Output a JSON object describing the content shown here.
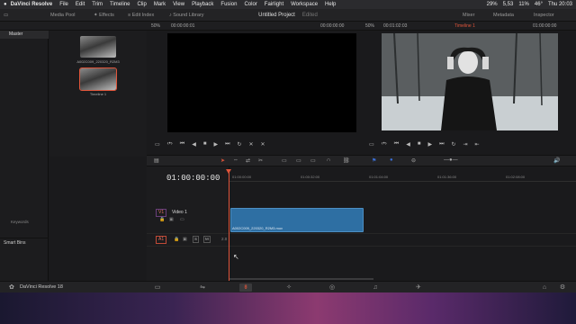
{
  "menubar": {
    "app": "DaVinci Resolve",
    "items": [
      "File",
      "Edit",
      "Trim",
      "Timeline",
      "Clip",
      "Mark",
      "View",
      "Playback",
      "Fusion",
      "Color",
      "Fairlight",
      "Workspace",
      "Help"
    ],
    "battery": "29%",
    "cpu": "5,53",
    "volume": "11%",
    "temp": "46°",
    "clock": "Thu 20:03"
  },
  "toolbar": {
    "media_pool": "Media Pool",
    "effects": "Effects",
    "edit_index": "Edit Index",
    "sound_library": "Sound Library",
    "project_title": "Untitled Project",
    "edited": "Edited",
    "mixer": "Mixer",
    "metadata": "Metadata",
    "inspector": "Inspector"
  },
  "bar2": {
    "src_zoom": "50%",
    "src_tc_left": "00:00:00:01",
    "src_tc_right": "00:00:00:00",
    "prog_zoom": "50%",
    "prog_tc": "00:01:02:03",
    "timeline_name": "Timeline 1",
    "prog_tc_right": "01:00:00:00"
  },
  "left_panel": {
    "master": "Master",
    "smart_bins": "Smart Bins",
    "keywords": "Keywords"
  },
  "media_pool": {
    "clips": [
      {
        "label": "A002C009_220320_R2M3"
      },
      {
        "label": "Timeline 1"
      }
    ]
  },
  "timeline": {
    "timecode": "01:00:00:00",
    "ruler": [
      "01:00:00:00",
      "01:00:32:00",
      "01:01:04:00",
      "01:01:36:00",
      "01:02:08:00"
    ],
    "video_track": {
      "tag": "V1",
      "name": "Video 1"
    },
    "audio_track": {
      "tag": "A1",
      "level": "2.0"
    },
    "clip_name": "A002C009_220320_R2M3.mov"
  },
  "bottom": {
    "app_label": "DaVinci Resolve 18"
  },
  "colors": {
    "accent": "#e0553a",
    "clip_blue": "#2e6fa3"
  }
}
